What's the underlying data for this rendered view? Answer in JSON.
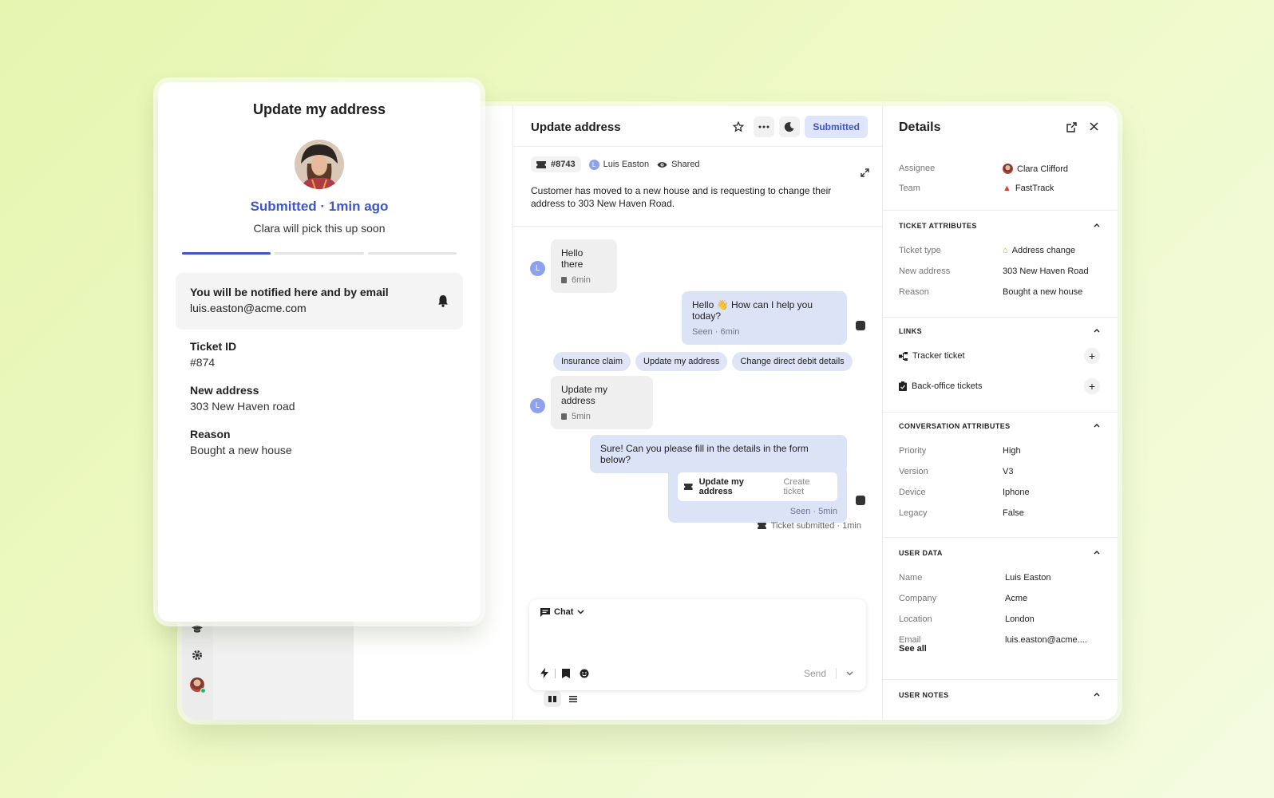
{
  "conversation": {
    "title": "Update address",
    "status_pill": "Submitted",
    "ticket_chip": "#8743",
    "customer": "Luis Easton",
    "customer_initial": "L",
    "visibility": "Shared",
    "summary": "Customer has moved to a new house and is requesting to change their address to 303 New Haven Road.",
    "messages": [
      {
        "text": "Hello there",
        "time": "6min"
      },
      {
        "text": "Hello 👋 How can I help you today?",
        "time": "Seen · 6min"
      },
      {
        "text": "Update my address",
        "time": "5min"
      },
      {
        "text": "Sure! Can you please fill in the details in the form below?"
      },
      {
        "card_title": "Update my address",
        "card_action": "Create ticket",
        "time": "Seen · 5min"
      }
    ],
    "quick_replies": [
      "Insurance claim",
      "Update my address",
      "Change direct debit details"
    ],
    "ticket_submitted": "Ticket submitted · 1min",
    "composer": {
      "tab": "Chat",
      "send": "Send"
    }
  },
  "details": {
    "title": "Details",
    "assignee_label": "Assignee",
    "assignee": "Clara Clifford",
    "team_label": "Team",
    "team": "FastTrack",
    "ticket_attributes": {
      "header": "TICKET ATTRIBUTES",
      "rows": [
        {
          "k": "Ticket type",
          "v": "Address change"
        },
        {
          "k": "New address",
          "v": "303 New Haven Road"
        },
        {
          "k": "Reason",
          "v": "Bought a new house"
        }
      ]
    },
    "links": {
      "header": "LINKS",
      "items": [
        "Tracker ticket",
        "Back-office tickets"
      ]
    },
    "conversation_attributes": {
      "header": "CONVERSATION ATTRIBUTES",
      "rows": [
        {
          "k": "Priority",
          "v": "High"
        },
        {
          "k": "Version",
          "v": "V3"
        },
        {
          "k": "Device",
          "v": "Iphone"
        },
        {
          "k": "Legacy",
          "v": "False"
        }
      ]
    },
    "user_data": {
      "header": "USER DATA",
      "rows": [
        {
          "k": "Name",
          "v": "Luis Easton"
        },
        {
          "k": "Company",
          "v": "Acme"
        },
        {
          "k": "Location",
          "v": "London"
        },
        {
          "k": "Email",
          "v": "luis.easton@acme...."
        }
      ],
      "see_all": "See all"
    },
    "user_notes": {
      "header": "USER NOTES"
    }
  },
  "messenger": {
    "title": "Update my address",
    "status": "Submitted · 1min ago",
    "subtitle": "Clara will pick this up soon",
    "progress_steps": 3,
    "progress_completed": 1,
    "notify_title": "You will be notified here and by email",
    "notify_email": "luis.easton@acme.com",
    "fields": [
      {
        "label": "Ticket ID",
        "value": "#874"
      },
      {
        "label": "New address",
        "value": "303 New Haven road"
      },
      {
        "label": "Reason",
        "value": "Bought a new house"
      }
    ]
  },
  "colors": {
    "accent": "#3f56c9",
    "pill_bg": "#dfe5fb",
    "bubble_out": "#dde3f7",
    "bubble_in": "#efefef"
  },
  "icons": [
    "star-icon",
    "more-icon",
    "snooze-icon",
    "external-link-icon",
    "close-icon",
    "expand-icon",
    "ticket-icon",
    "eye-icon",
    "bell-icon",
    "bolt-icon",
    "bookmark-icon",
    "emoji-icon",
    "chevron-up-icon",
    "plus-icon",
    "settings-icon",
    "academy-icon"
  ]
}
